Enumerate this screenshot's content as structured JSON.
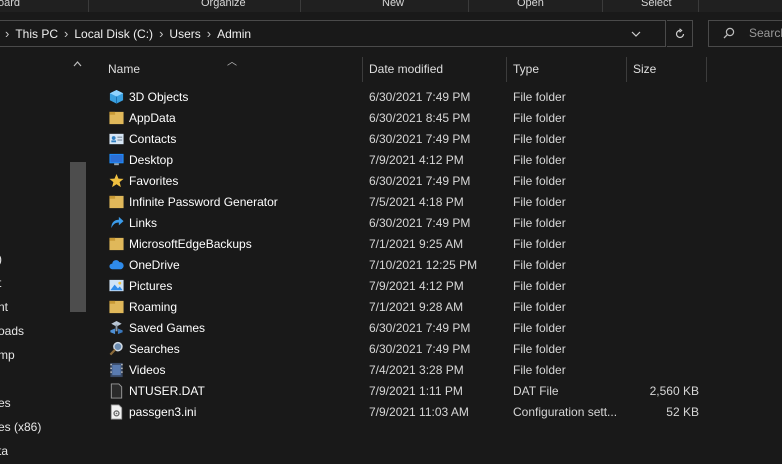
{
  "ribbon": {
    "groups": [
      "oard",
      "Organize",
      "New",
      "Open",
      "Select"
    ]
  },
  "address": {
    "crumbs": [
      "This PC",
      "Local Disk (C:)",
      "Users",
      "Admin"
    ],
    "separator": "›"
  },
  "search": {
    "placeholder": "Search"
  },
  "nav": {
    "items": [
      ")",
      "t",
      "nt",
      "oads",
      "mp",
      "es",
      "es (x86)",
      "ta"
    ]
  },
  "columns": {
    "name": "Name",
    "date": "Date modified",
    "type": "Type",
    "size": "Size"
  },
  "files": [
    {
      "name": "3D Objects",
      "date": "6/30/2021 7:49 PM",
      "type": "File folder",
      "size": "",
      "icon": "3d-objects-icon"
    },
    {
      "name": "AppData",
      "date": "6/30/2021 8:45 PM",
      "type": "File folder",
      "size": "",
      "icon": "folder-icon"
    },
    {
      "name": "Contacts",
      "date": "6/30/2021 7:49 PM",
      "type": "File folder",
      "size": "",
      "icon": "contacts-icon"
    },
    {
      "name": "Desktop",
      "date": "7/9/2021 4:12 PM",
      "type": "File folder",
      "size": "",
      "icon": "desktop-icon"
    },
    {
      "name": "Favorites",
      "date": "6/30/2021 7:49 PM",
      "type": "File folder",
      "size": "",
      "icon": "star-icon"
    },
    {
      "name": "Infinite Password Generator",
      "date": "7/5/2021 4:18 PM",
      "type": "File folder",
      "size": "",
      "icon": "folder-icon"
    },
    {
      "name": "Links",
      "date": "6/30/2021 7:49 PM",
      "type": "File folder",
      "size": "",
      "icon": "link-arrow-icon"
    },
    {
      "name": "MicrosoftEdgeBackups",
      "date": "7/1/2021 9:25 AM",
      "type": "File folder",
      "size": "",
      "icon": "folder-icon"
    },
    {
      "name": "OneDrive",
      "date": "7/10/2021 12:25 PM",
      "type": "File folder",
      "size": "",
      "icon": "cloud-icon"
    },
    {
      "name": "Pictures",
      "date": "7/9/2021 4:12 PM",
      "type": "File folder",
      "size": "",
      "icon": "pictures-icon"
    },
    {
      "name": "Roaming",
      "date": "7/1/2021 9:28 AM",
      "type": "File folder",
      "size": "",
      "icon": "folder-icon"
    },
    {
      "name": "Saved Games",
      "date": "6/30/2021 7:49 PM",
      "type": "File folder",
      "size": "",
      "icon": "saved-games-icon"
    },
    {
      "name": "Searches",
      "date": "6/30/2021 7:49 PM",
      "type": "File folder",
      "size": "",
      "icon": "magnifier-icon"
    },
    {
      "name": "Videos",
      "date": "7/4/2021 3:28 PM",
      "type": "File folder",
      "size": "",
      "icon": "videos-icon"
    },
    {
      "name": "NTUSER.DAT",
      "date": "7/9/2021 1:11 PM",
      "type": "DAT File",
      "size": "2,560 KB",
      "icon": "file-icon"
    },
    {
      "name": "passgen3.ini",
      "date": "7/9/2021 11:03 AM",
      "type": "Configuration sett...",
      "size": "52 KB",
      "icon": "settings-file-icon"
    }
  ]
}
